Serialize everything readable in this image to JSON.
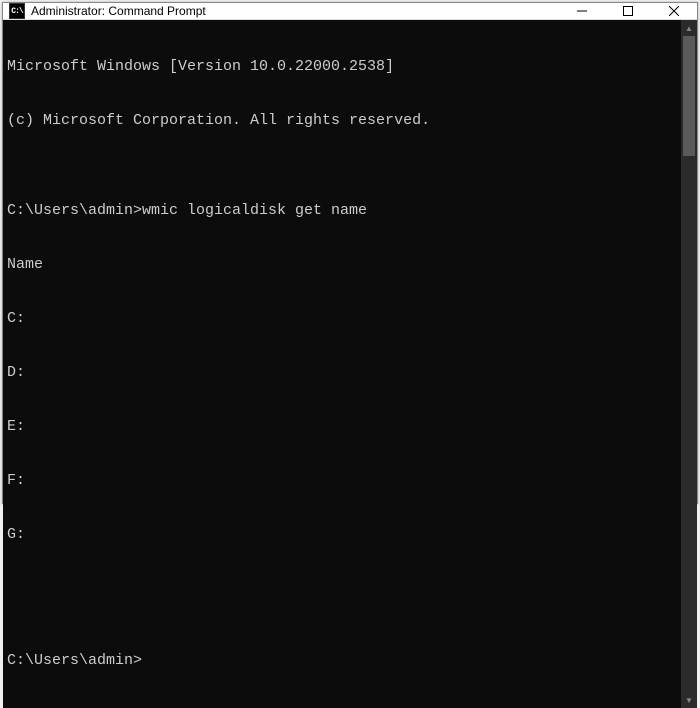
{
  "window": {
    "icon_text": "C:\\",
    "title": "Administrator: Command Prompt"
  },
  "terminal": {
    "lines": [
      "Microsoft Windows [Version 10.0.22000.2538]",
      "(c) Microsoft Corporation. All rights reserved.",
      "",
      "C:\\Users\\admin>wmic logicaldisk get name",
      "Name",
      "C:",
      "D:",
      "E:",
      "F:",
      "G:",
      "",
      "",
      "C:\\Users\\admin>"
    ]
  }
}
